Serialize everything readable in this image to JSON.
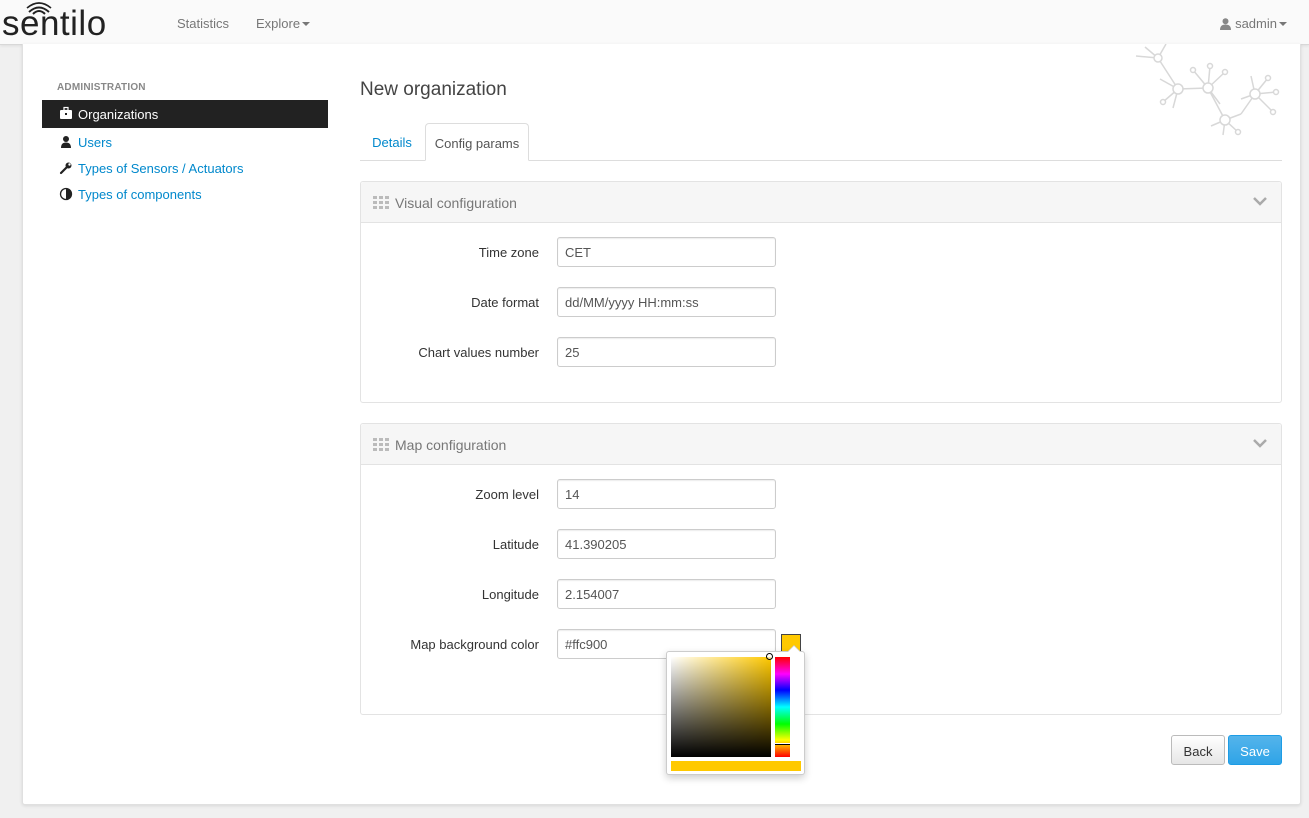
{
  "brand": {
    "name": "sentilo"
  },
  "nav": {
    "statistics": "Statistics",
    "explore": "Explore",
    "user": "sadmin"
  },
  "sidebar": {
    "header": "ADMINISTRATION",
    "items": [
      {
        "label": "Organizations",
        "icon": "briefcase-icon",
        "active": true
      },
      {
        "label": "Users",
        "icon": "user-icon",
        "active": false
      },
      {
        "label": "Types of Sensors / Actuators",
        "icon": "wrench-icon",
        "active": false
      },
      {
        "label": "Types of components",
        "icon": "contrast-icon",
        "active": false
      }
    ]
  },
  "main": {
    "title": "New organization",
    "tabs": [
      {
        "label": "Details",
        "active": false
      },
      {
        "label": "Config params",
        "active": true
      }
    ]
  },
  "visual_config": {
    "title": "Visual configuration",
    "fields": [
      {
        "label": "Time zone",
        "value": "CET"
      },
      {
        "label": "Date format",
        "value": "dd/MM/yyyy HH:mm:ss"
      },
      {
        "label": "Chart values number",
        "value": "25"
      }
    ]
  },
  "map_config": {
    "title": "Map configuration",
    "fields": [
      {
        "label": "Zoom level",
        "value": "14"
      },
      {
        "label": "Latitude",
        "value": "41.390205"
      },
      {
        "label": "Longitude",
        "value": "2.154007"
      },
      {
        "label": "Map background color",
        "value": "#ffc900"
      }
    ]
  },
  "buttons": {
    "back": "Back",
    "save": "Save"
  },
  "colors": {
    "accent": "#2fa4e7",
    "link": "#0088cc",
    "selected_color": "#ffc900",
    "sidebar_active": "#222222"
  }
}
